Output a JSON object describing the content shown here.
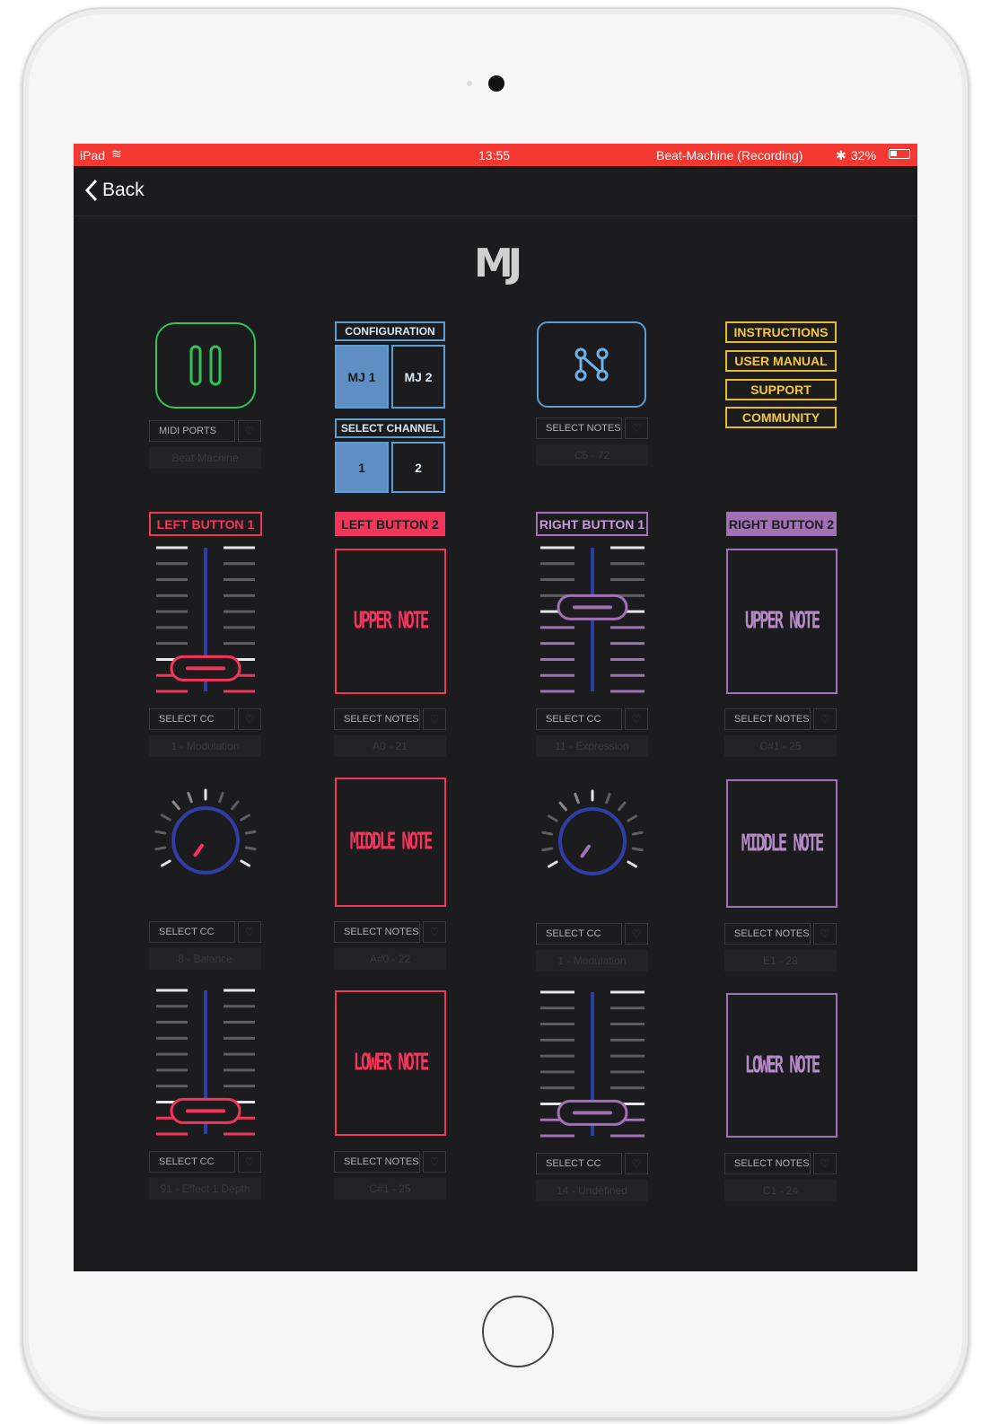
{
  "status_bar": {
    "device": "iPad",
    "time": "13:55",
    "app_status": "Beat-Machine (Recording)",
    "battery": "32%"
  },
  "nav": {
    "back_label": "Back"
  },
  "logo": "MJ",
  "col1_top": {
    "select_label": "MIDI PORTS",
    "value": "Beat-Machine"
  },
  "configuration": {
    "header": "CONFIGURATION",
    "tabs": [
      "MJ 1",
      "MJ 2"
    ],
    "selected": "MJ 1"
  },
  "channel": {
    "header": "SELECT CHANNEL",
    "tabs": [
      "1",
      "2"
    ],
    "selected": "1"
  },
  "col3_top": {
    "select_label": "SELECT NOTES",
    "value": "C5 - 72"
  },
  "links": [
    "INSTRUCTIONS",
    "USER MANUAL",
    "SUPPORT",
    "COMMUNITY"
  ],
  "button_labels": [
    "LEFT BUTTON 1",
    "LEFT BUTTON 2",
    "RIGHT BUTTON 1",
    "RIGHT BUTTON 2"
  ],
  "pads": {
    "upper": "UPPER NOTE",
    "middle": "MIDDLE NOTE",
    "lower": "LOWER NOTE"
  },
  "controls": {
    "r1c1": {
      "select_label": "SELECT CC",
      "value": "1 - Modulation",
      "fader_level": 0.1
    },
    "r1c2": {
      "select_label": "SELECT NOTES",
      "value": "A0 - 21"
    },
    "r1c3": {
      "select_label": "SELECT CC",
      "value": "11 - Expression",
      "fader_level": 0.6
    },
    "r1c4": {
      "select_label": "SELECT NOTES",
      "value": "C#1 - 25"
    },
    "r2c1": {
      "select_label": "SELECT CC",
      "value": "8 - Balance"
    },
    "r2c2": {
      "select_label": "SELECT NOTES",
      "value": "A#0 - 22"
    },
    "r2c3": {
      "select_label": "SELECT CC",
      "value": "1 - Modulation"
    },
    "r2c4": {
      "select_label": "SELECT NOTES",
      "value": "E1 - 28"
    },
    "r3c1": {
      "select_label": "SELECT CC",
      "value": "91 - Effect 1 Depth",
      "fader_level": 0.1
    },
    "r3c2": {
      "select_label": "SELECT NOTES",
      "value": "C#1 - 25"
    },
    "r3c3": {
      "select_label": "SELECT CC",
      "value": "14 - Undefined",
      "fader_level": 0.1
    },
    "r3c4": {
      "select_label": "SELECT NOTES",
      "value": "C1 - 24"
    }
  },
  "colors": {
    "red": "#f2355a",
    "purple": "#a170b5",
    "blue": "#5a9fd4",
    "green": "#32c35a",
    "yellow": "#e8b92b",
    "fader_blue": "#2f3ea6"
  }
}
